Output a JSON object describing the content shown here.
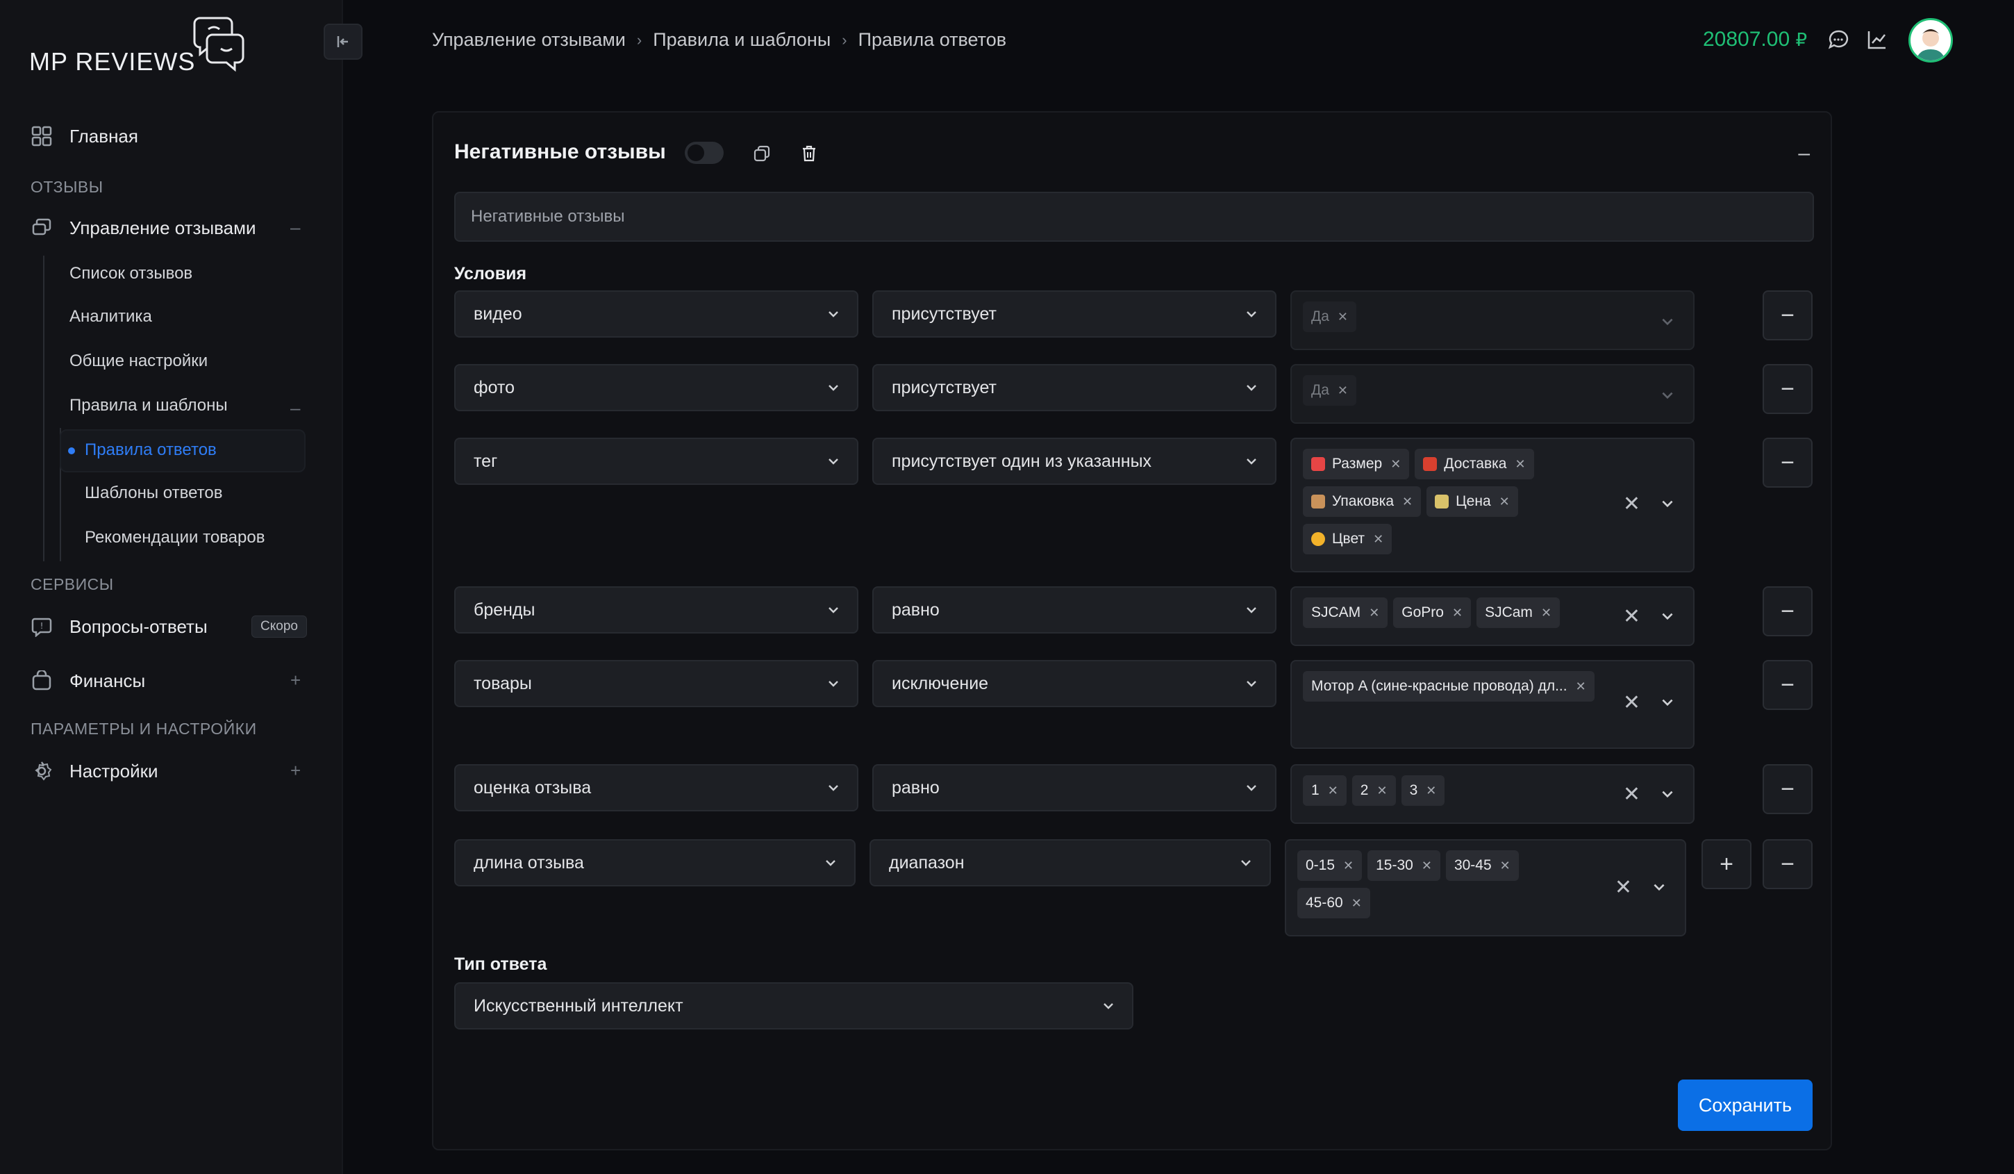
{
  "logo": {
    "text": "MP REVIEWS"
  },
  "sidebar": {
    "home": "Главная",
    "section_reviews": "ОТЗЫВЫ",
    "reviews_mgmt": "Управление отзывами",
    "reviews_mgmt_toggle": "–",
    "sub_list": "Список отзывов",
    "sub_analytics": "Аналитика",
    "sub_general": "Общие настройки",
    "sub_rules": "Правила и шаблоны",
    "sub_rules_toggle": "–",
    "sub_rules_answers": "Правила ответов",
    "sub_templates": "Шаблоны ответов",
    "sub_recommend": "Рекомендации товаров",
    "section_services": "СЕРВИСЫ",
    "qa": "Вопросы-ответы",
    "qa_badge": "Скоро",
    "finance": "Финансы",
    "finance_toggle": "+",
    "section_params": "ПАРАМЕТРЫ И НАСТРОЙКИ",
    "settings": "Настройки",
    "settings_toggle": "+"
  },
  "breadcrumb": [
    "Управление отзывами",
    "Правила и шаблоны",
    "Правила ответов"
  ],
  "header": {
    "balance": "20807.00",
    "currency": "₽"
  },
  "card": {
    "title": "Негативные отзывы",
    "enabled": false,
    "collapse": "–",
    "name_value": "Негативные отзывы",
    "conditions_label": "Условия",
    "answer_type_label": "Тип ответа",
    "answer_type_value": "Искусственный интеллект",
    "save": "Сохранить",
    "conditions": [
      {
        "field": "видео",
        "op": "присутствует",
        "values": [
          "Да"
        ]
      },
      {
        "field": "фото",
        "op": "присутствует",
        "values": [
          "Да"
        ]
      },
      {
        "field": "тег",
        "op": "присутствует один из указанных",
        "values": [
          "Размер",
          "Доставка",
          "Упаковка",
          "Цена",
          "Цвет"
        ]
      },
      {
        "field": "бренды",
        "op": "равно",
        "values": [
          "SJCAM",
          "GoPro",
          "SJCam"
        ]
      },
      {
        "field": "товары",
        "op": "исключение",
        "values": [
          "Мотор A (сине-красные провода) дл..."
        ]
      },
      {
        "field": "оценка отзыва",
        "op": "равно",
        "values": [
          "1",
          "2",
          "3"
        ]
      },
      {
        "field": "длина отзыва",
        "op": "диапазон",
        "values": [
          "0-15",
          "15-30",
          "30-45",
          "45-60"
        ]
      }
    ]
  },
  "buttons": {
    "remove": "−",
    "add": "+",
    "clear": "✕"
  },
  "colors": {
    "accent": "#2f7df6",
    "balance": "#1fbf75",
    "save": "#0b6fe6"
  }
}
